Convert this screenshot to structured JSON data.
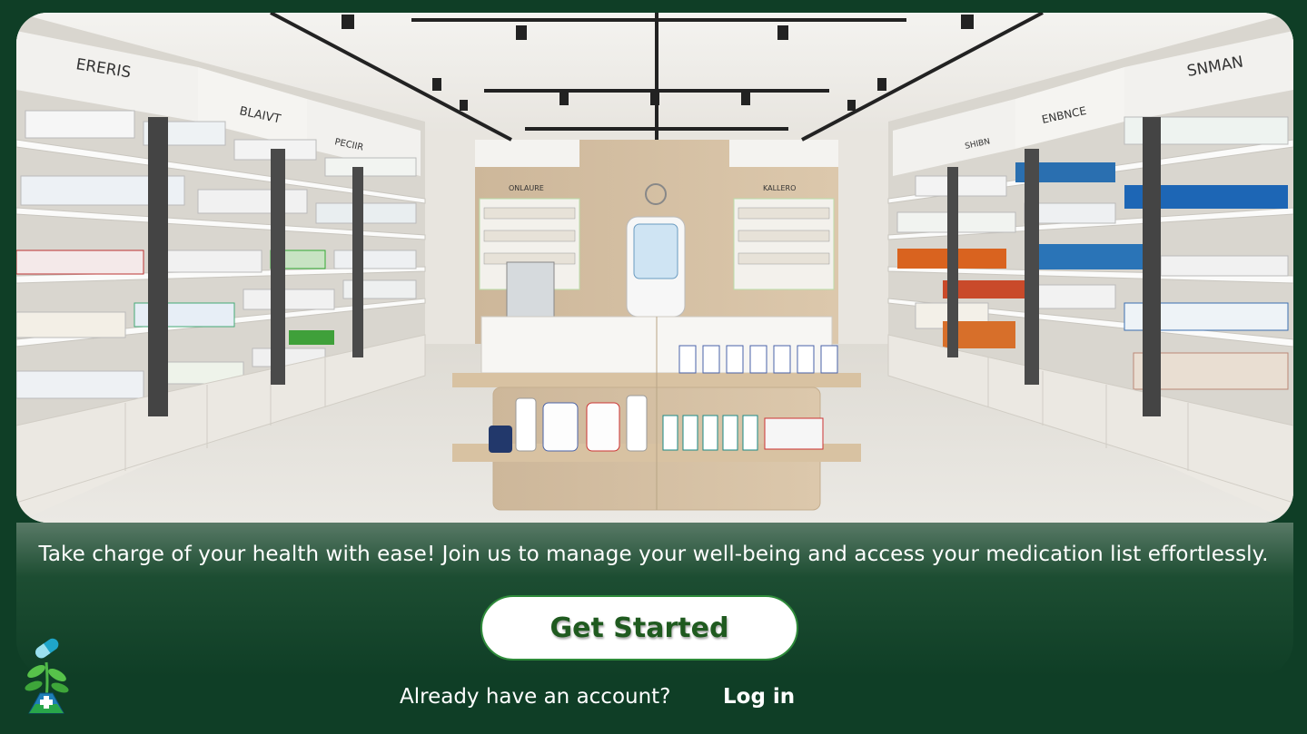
{
  "hero": {
    "image_semantic": "pharmacy-interior-photo"
  },
  "tagline": "Take charge of your health with ease! Join us to manage your well-being and access your medication list effortlessly.",
  "cta": {
    "label": "Get Started"
  },
  "account": {
    "question": "Already have an account?",
    "login_label": "Log in"
  },
  "logo": {
    "icon": "pharmacy-plant-logo-icon"
  },
  "colors": {
    "background": "#0f3e26",
    "button_text": "#1f5a1f",
    "button_border": "#2e8b3a",
    "text": "#ffffff"
  }
}
